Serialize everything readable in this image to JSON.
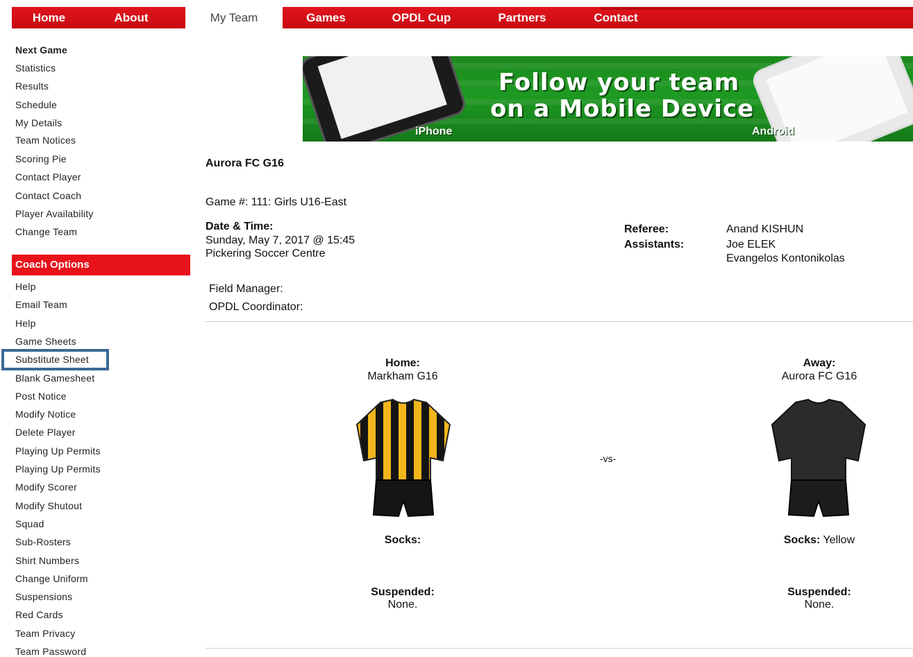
{
  "nav": {
    "items": [
      "Home",
      "About",
      "My Team",
      "Games",
      "OPDL Cup",
      "Partners",
      "Contact"
    ],
    "active": "My Team"
  },
  "sidebar": {
    "team_links": [
      "Next Game",
      "Statistics",
      "Results",
      "Schedule",
      "My Details",
      "Team Notices",
      "Scoring Pie",
      "Contact Player",
      "Contact Coach",
      "Player Availability",
      "Change Team"
    ],
    "coach_header": "Coach Options",
    "coach_links": [
      "Help",
      "Email Team",
      "Help",
      "Game Sheets",
      "Substitute Sheet",
      "Blank Gamesheet",
      "Post Notice",
      "Modify Notice",
      "Delete Player",
      "Playing Up Permits",
      "Playing Up Permits",
      "Modify Scorer",
      "Modify Shutout",
      "Squad",
      "Sub-Rosters",
      "Shirt Numbers",
      "Change Uniform",
      "Suspensions",
      "Red Cards",
      "Team Privacy",
      "Team Password"
    ],
    "highlighted": "Substitute Sheet"
  },
  "banner": {
    "line1": "Follow your team",
    "line2": "on a Mobile Device",
    "left_label": "iPhone",
    "right_label": "Android"
  },
  "game": {
    "team_title": "Aurora FC G16",
    "game_label": "Game #:",
    "game_value": " 111: Girls U16-East",
    "datetime_label": "Date & Time:",
    "datetime_value": "Sunday, May 7, 2017 @ 15:45",
    "venue": "Pickering Soccer Centre",
    "referee_label": "Referee:",
    "referee_value": "Anand KISHUN",
    "assistants_label": "Assistants:",
    "assistant_1": "Joe ELEK",
    "assistant_2": "Evangelos Kontonikolas",
    "field_manager_label": "Field Manager:",
    "coordinator_label": "OPDL Coordinator:"
  },
  "matchup": {
    "home_label": "Home:",
    "home_team": "Markham G16",
    "away_label": "Away:",
    "away_team": "Aurora FC G16",
    "vs": "-vs-",
    "socks_label": "Socks:",
    "home_socks": "",
    "away_socks": " Yellow",
    "suspended_label": "Suspended:",
    "home_suspended": "None.",
    "away_suspended": "None.",
    "home_kit_colors": [
      "#f2b51c",
      "#111111"
    ],
    "away_kit_color": "#2b2b2b"
  }
}
